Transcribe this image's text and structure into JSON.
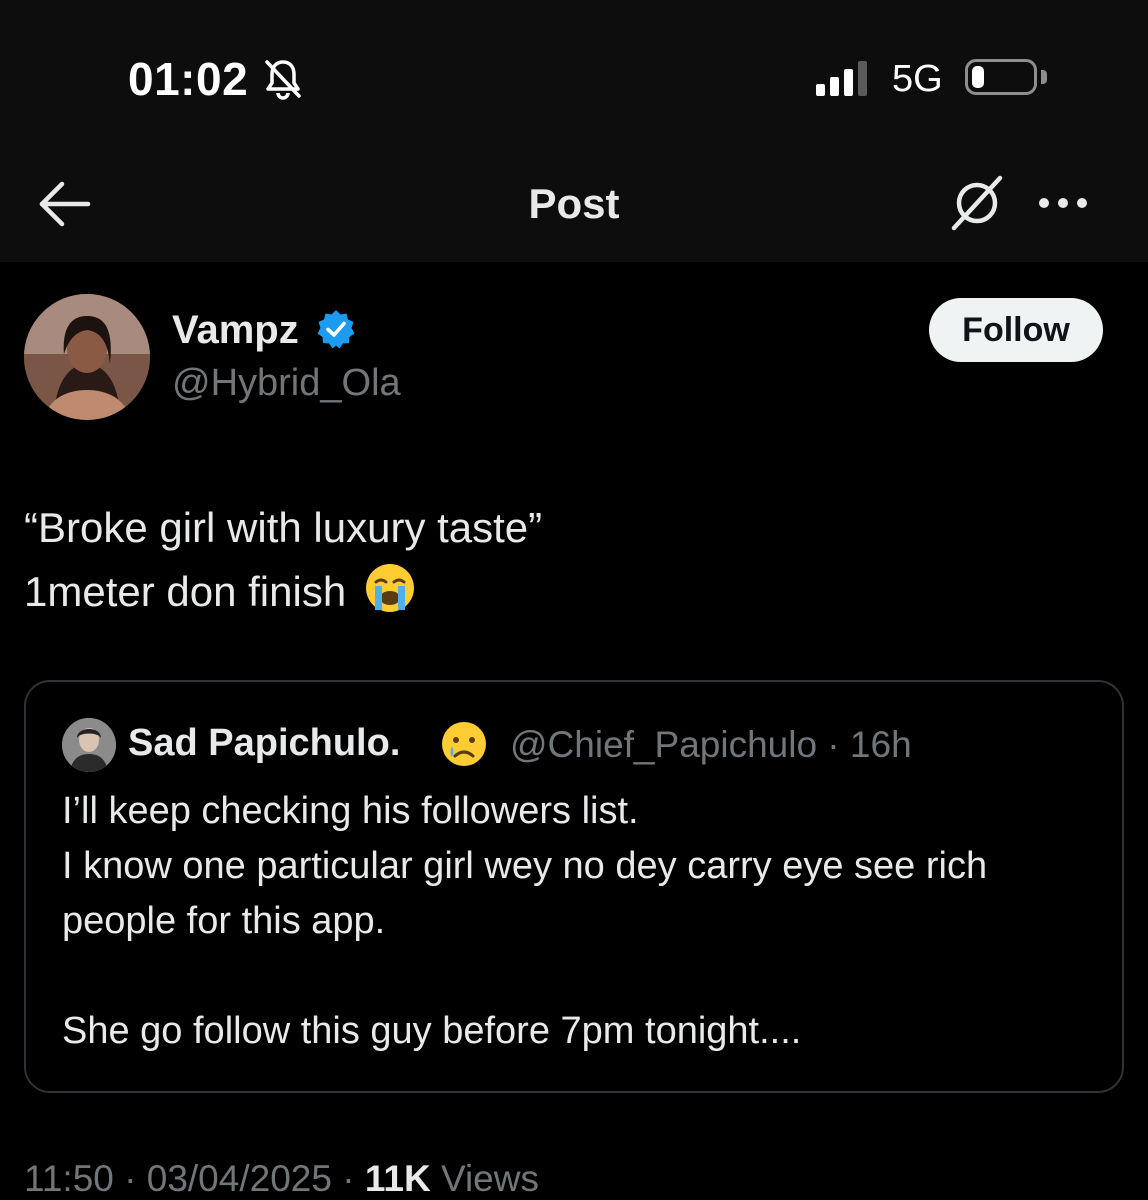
{
  "status_bar": {
    "time": "01:02",
    "network": "5G",
    "battery_level": 0.2
  },
  "header": {
    "title": "Post"
  },
  "post": {
    "author": {
      "name": "Vampz",
      "handle": "@Hybrid_Ola",
      "verified": true
    },
    "follow_label": "Follow",
    "text_line1": "“Broke girl with luxury taste”",
    "text_line2": "1meter don finish",
    "text_emoji": "loudly-crying-face",
    "quoted": {
      "name": "Sad Papichulo.",
      "name_emoji": "crying-face",
      "handle": "@Chief_Papichulo",
      "separator": " · ",
      "age": "16h",
      "text": "I’ll keep checking his followers list.\nI know one particular girl wey no dey carry eye see rich people for this app.\n\nShe go follow this guy before 7pm tonight...."
    },
    "meta": {
      "time": "11:50",
      "date": "03/04/2025",
      "views_count": "11K",
      "views_label": "Views",
      "separator": " · "
    }
  },
  "colors": {
    "background": "#000000",
    "header_background": "#0d0d0d",
    "primary_text": "#e7e9ea",
    "secondary_text": "#71767b",
    "verified_blue": "#1d9bf0",
    "border": "#2f3336",
    "follow_button_bg": "#eff3f4"
  }
}
